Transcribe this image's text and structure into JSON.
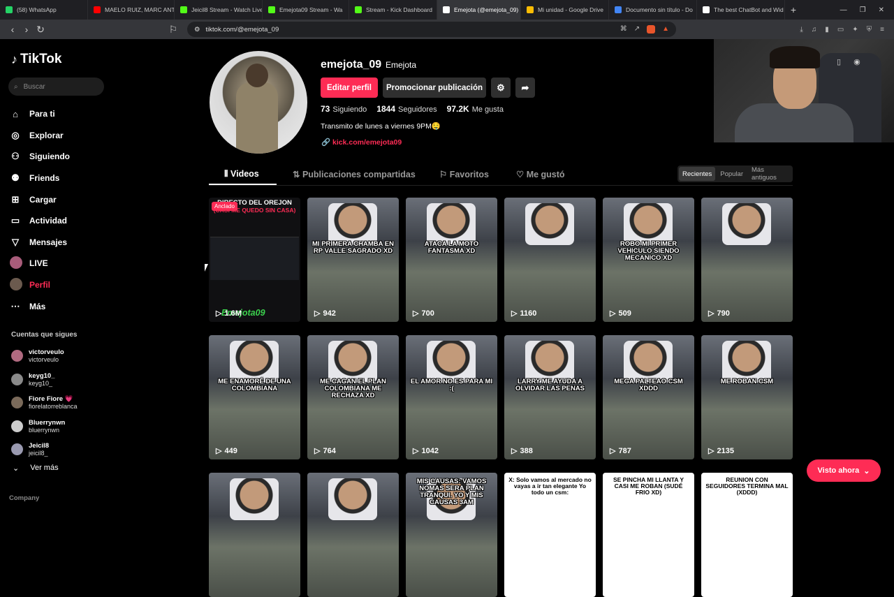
{
  "browser": {
    "tabs": [
      {
        "title": "(58) WhatsApp",
        "color": "#25d366"
      },
      {
        "title": "MAELO RUIZ, MARC ANTHONY",
        "color": "#ff0000"
      },
      {
        "title": "Jeicil8 Stream - Watch Live",
        "color": "#53fc18"
      },
      {
        "title": "Emejota09 Stream - Wa",
        "color": "#53fc18"
      },
      {
        "title": "Stream - Kick Dashboard",
        "color": "#53fc18"
      },
      {
        "title": "Emejota (@emejota_09)",
        "color": "#ffffff",
        "active": true
      },
      {
        "title": "Mi unidad - Google Drive",
        "color": "#fbbc04"
      },
      {
        "title": "Documento sin título - Do",
        "color": "#4285f4"
      },
      {
        "title": "The best ChatBot and Wid",
        "color": "#ffffff"
      }
    ],
    "url": "tiktok.com/@emejota_09",
    "new_tab": "+"
  },
  "sidebar": {
    "logo": "TikTok",
    "search_placeholder": "Buscar",
    "nav": [
      {
        "label": "Para ti",
        "icon": "home-icon"
      },
      {
        "label": "Explorar",
        "icon": "compass-icon"
      },
      {
        "label": "Siguiendo",
        "icon": "following-icon"
      },
      {
        "label": "Friends",
        "icon": "friends-icon"
      },
      {
        "label": "Cargar",
        "icon": "upload-icon"
      },
      {
        "label": "Actividad",
        "icon": "inbox-icon"
      },
      {
        "label": "Mensajes",
        "icon": "send-icon"
      },
      {
        "label": "LIVE",
        "icon": "live-icon"
      },
      {
        "label": "Perfil",
        "icon": "profile-icon",
        "active": true
      },
      {
        "label": "Más",
        "icon": "more-icon"
      }
    ],
    "following_title": "Cuentas que sigues",
    "following": [
      {
        "name": "victorveulo",
        "user": "victorveulo"
      },
      {
        "name": "keyg10_",
        "user": "keyg10_"
      },
      {
        "name": "Fiore Fiore 💗",
        "user": "fiorelatorreblanca"
      },
      {
        "name": "Bluerrynwn",
        "user": "bluerrynwn"
      },
      {
        "name": "Jeicil8",
        "user": "jeicil8_"
      }
    ],
    "see_more": "Ver más",
    "company": "Company"
  },
  "profile": {
    "username": "emejota_09",
    "nickname": "Emejota",
    "edit_label": "Editar perfil",
    "promote_label": "Promocionar publicación",
    "following_count": "73",
    "following_label": "Siguiendo",
    "followers_count": "1844",
    "followers_label": "Seguidores",
    "likes_count": "97.2K",
    "likes_label": "Me gusta",
    "bio": "Transmito de lunes a viernes 9PM🤤",
    "link": "kick.com/emejota09"
  },
  "tabs": {
    "videos": "Videos",
    "shared": "Publicaciones compartidas",
    "favorites": "Favoritos",
    "liked": "Me gustó"
  },
  "sort": {
    "recent": "Recientes",
    "popular": "Popular",
    "oldest": "Más antiguos"
  },
  "pinned": {
    "badge": "Anclado",
    "title": "DIRECTO DEL OREJON",
    "subtitle": "(CASI ME QUEDO SIN CASA)",
    "watermark": "Emejota09",
    "views": "1.6M"
  },
  "videos": [
    {
      "caption": "MI PRIMERA CHAMBA EN RP VALLE SAGRADO XD",
      "views": "942"
    },
    {
      "caption": "ATACA LA MOTO FANTASMA XD",
      "views": "700"
    },
    {
      "caption": "",
      "views": "1160"
    },
    {
      "caption": "ROBO MI PRIMER VEHICULO SIENDO MECANICO XD",
      "views": "509"
    },
    {
      "caption": "",
      "views": "790"
    },
    {
      "caption": "ME ENAMORÉ DE UNA COLOMBIANA",
      "views": "449"
    },
    {
      "caption": "ME CAGAN EL PLAN COLOMBIANA ME RECHAZA XD",
      "views": "764"
    },
    {
      "caption": "EL AMOR NO ES PARA MI :(",
      "views": "1042"
    },
    {
      "caption": "LARRY ME AYUDA A OLVIDAR LAS PENAS",
      "views": "388"
    },
    {
      "caption": "MEGA PALTEAO CSM XDDD",
      "views": "787"
    },
    {
      "caption": "ME ROBAN CSM",
      "views": "2135"
    }
  ],
  "row3": [
    {
      "caption": "",
      "text": false
    },
    {
      "caption": "",
      "text": false
    },
    {
      "caption": "MIS CAUSAS: VAMOS NOMAS SERA PLAN TRANQUI. YO Y MIS CAUSAS 3AM",
      "text": false
    },
    {
      "caption": "X: Solo vamos al mercado no vayas a ir tan elegante  Yo todo un csm:",
      "text": true
    },
    {
      "caption": "SE PINCHA MI LLANTA Y CASI ME ROBAN (SUDÉ FRIO XD)",
      "text": true
    },
    {
      "caption": "REUNION CON SEGUIDORES TERMINA MAL (XDDD)",
      "text": true
    }
  ],
  "visto_label": "Visto ahora"
}
